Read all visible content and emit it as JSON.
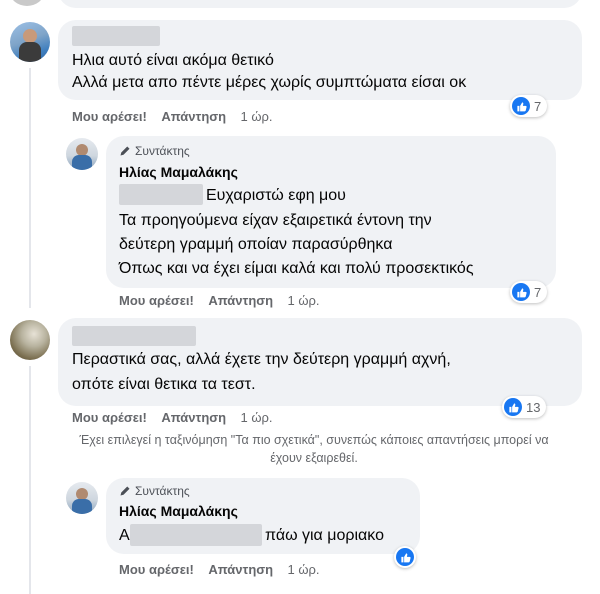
{
  "comment1": {
    "lines": [
      "Ηλια αυτό είναι ακόμα θετικό",
      "Αλλά μετα απο πέντε μέρες χωρίς συμπτώματα είσαι οκ"
    ],
    "like_label": "Μου αρέσει!",
    "reply_label": "Απάντηση",
    "time": "1 ώρ.",
    "reactions": "7"
  },
  "reply1": {
    "author_tag": "Συντάκτης",
    "author": "Ηλίας Μαμαλάκης",
    "lines": [
      "Ευχαριστώ εφη μου",
      "Τα προηγούμενα είχαν εξαιρετικά έντονη την",
      "δεύτερη γραμμή οποίαν παρασύρθηκα",
      "Όπως και να έχει είμαι καλά και πολύ προσεκτικός"
    ],
    "like_label": "Μου αρέσει!",
    "reply_label": "Απάντηση",
    "time": "1 ώρ.",
    "reactions": "7"
  },
  "comment2": {
    "lines": [
      "Περαστικά σας, αλλά έχετε την δεύτερη γραμμή αχνή,",
      "οπότε είναι θετικα τα τεστ."
    ],
    "like_label": "Μου αρέσει!",
    "reply_label": "Απάντηση",
    "time": "1 ώρ.",
    "reactions": "13"
  },
  "sort_note": "Έχει επιλεγεί η ταξινόμηση \"Τα πιο σχετικά\", συνεπώς κάποιες απαντήσεις μπορεί να έχουν εξαιρεθεί.",
  "reply2": {
    "author_tag": "Συντάκτης",
    "author": "Ηλίας Μαμαλάκης",
    "lead": "Α",
    "text": "πάω για μοριακο",
    "like_label": "Μου αρέσει!",
    "reply_label": "Απάντηση",
    "time": "1 ώρ."
  },
  "colors": {
    "accent": "#1877f2",
    "bubble": "#f0f2f5",
    "meta": "#65676b"
  }
}
